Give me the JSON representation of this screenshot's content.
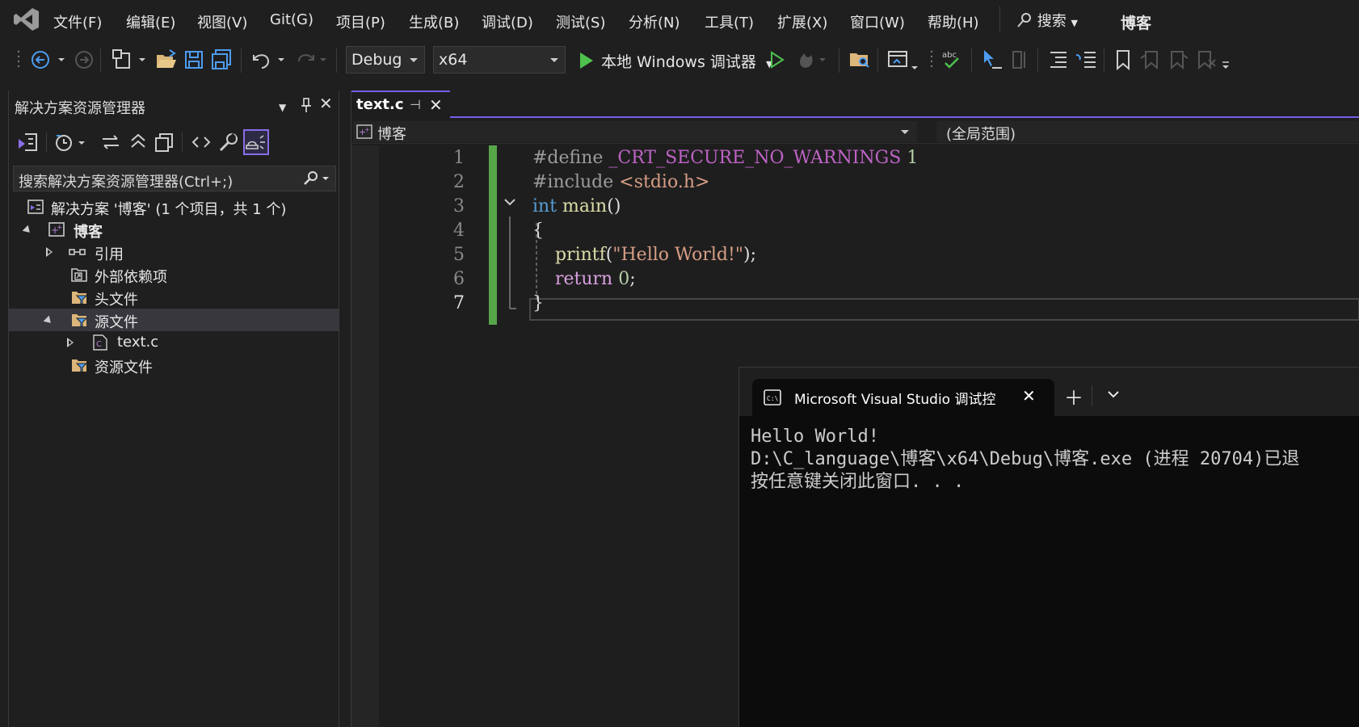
{
  "app": {
    "title": "博客"
  },
  "menu": {
    "items": [
      "文件(F)",
      "编辑(E)",
      "视图(V)",
      "Git(G)",
      "项目(P)",
      "生成(B)",
      "调试(D)",
      "测试(S)",
      "分析(N)",
      "工具(T)",
      "扩展(X)",
      "窗口(W)",
      "帮助(H)"
    ],
    "search_label": "搜索"
  },
  "toolbar": {
    "configuration": "Debug",
    "platform": "x64",
    "run_label": "本地 Windows 调试器"
  },
  "solution_explorer": {
    "title": "解决方案资源管理器",
    "search_placeholder": "搜索解决方案资源管理器(Ctrl+;)",
    "tree": {
      "solution": "解决方案 '博客' (1 个项目，共 1 个)",
      "project": "博客",
      "references": "引用",
      "external_deps": "外部依赖项",
      "header_files": "头文件",
      "source_files": "源文件",
      "text_c": "text.c",
      "resource_files": "资源文件"
    }
  },
  "editor": {
    "tab": {
      "name": "text.c"
    },
    "navbar": {
      "project": "博客",
      "scope": "(全局范围)"
    },
    "lines": [
      {
        "num": "1",
        "text": "#define _CRT_SECURE_NO_WARNINGS 1"
      },
      {
        "num": "2",
        "text": "#include <stdio.h>"
      },
      {
        "num": "3",
        "text": "int main()"
      },
      {
        "num": "4",
        "text": "{"
      },
      {
        "num": "5",
        "text": "    printf(\"Hello World!\");"
      },
      {
        "num": "6",
        "text": "    return 0;"
      },
      {
        "num": "7",
        "text": "}"
      }
    ],
    "tokens": {
      "l1_pp": "#define",
      "l1_macro": "_CRT_SECURE_NO_WARNINGS",
      "l1_num": "1",
      "l2_pp": "#include",
      "l2_hdr": "<stdio.h>",
      "l3_type": "int",
      "l3_fn": "main",
      "l3_paren": "()",
      "l4": "{",
      "l5_fn": "printf",
      "l5_open": "(",
      "l5_str": "\"Hello World!\"",
      "l5_close": ");",
      "l6_kw": "return",
      "l6_num": "0",
      "l6_semi": ";",
      "l7": "}"
    }
  },
  "terminal": {
    "tab_title": "Microsoft Visual Studio 调试控制台",
    "output": [
      "Hello World!",
      "D:\\C_language\\博客\\x64\\Debug\\博客.exe (进程 20704)已退",
      "按任意键关闭此窗口. . ."
    ]
  },
  "colors": {
    "accent": "#7160e8",
    "change_bar": "#57a64a",
    "play_green": "#4ec14e"
  }
}
